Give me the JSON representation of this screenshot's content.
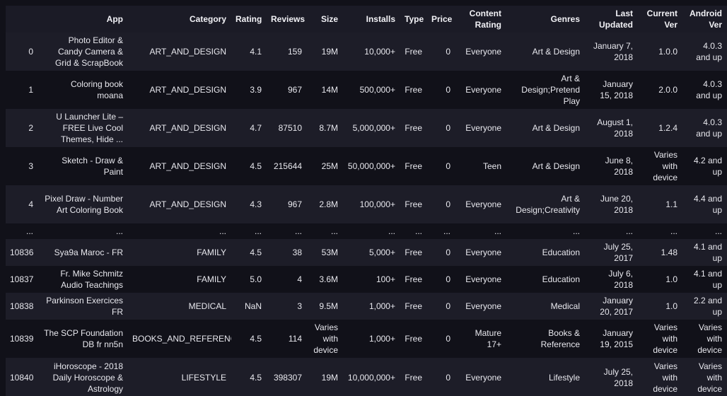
{
  "table": {
    "index_header": "",
    "columns": [
      "App",
      "Category",
      "Rating",
      "Reviews",
      "Size",
      "Installs",
      "Type",
      "Price",
      "Content Rating",
      "Genres",
      "Last Updated",
      "Current Ver",
      "Android Ver"
    ],
    "rows": [
      {
        "index": "0",
        "cells": [
          "Photo Editor & Candy Camera & Grid & ScrapBook",
          "ART_AND_DESIGN",
          "4.1",
          "159",
          "19M",
          "10,000+",
          "Free",
          "0",
          "Everyone",
          "Art & Design",
          "January 7, 2018",
          "1.0.0",
          "4.0.3 and up"
        ]
      },
      {
        "index": "1",
        "cells": [
          "Coloring book moana",
          "ART_AND_DESIGN",
          "3.9",
          "967",
          "14M",
          "500,000+",
          "Free",
          "0",
          "Everyone",
          "Art & Design;Pretend Play",
          "January 15, 2018",
          "2.0.0",
          "4.0.3 and up"
        ]
      },
      {
        "index": "2",
        "cells": [
          "U Launcher Lite – FREE Live Cool Themes, Hide ...",
          "ART_AND_DESIGN",
          "4.7",
          "87510",
          "8.7M",
          "5,000,000+",
          "Free",
          "0",
          "Everyone",
          "Art & Design",
          "August 1, 2018",
          "1.2.4",
          "4.0.3 and up"
        ]
      },
      {
        "index": "3",
        "cells": [
          "Sketch - Draw & Paint",
          "ART_AND_DESIGN",
          "4.5",
          "215644",
          "25M",
          "50,000,000+",
          "Free",
          "0",
          "Teen",
          "Art & Design",
          "June 8, 2018",
          "Varies with device",
          "4.2 and up"
        ]
      },
      {
        "index": "4",
        "cells": [
          "Pixel Draw - Number Art Coloring Book",
          "ART_AND_DESIGN",
          "4.3",
          "967",
          "2.8M",
          "100,000+",
          "Free",
          "0",
          "Everyone",
          "Art & Design;Creativity",
          "June 20, 2018",
          "1.1",
          "4.4 and up"
        ]
      },
      {
        "index": "...",
        "cells": [
          "...",
          "...",
          "...",
          "...",
          "...",
          "...",
          "...",
          "...",
          "...",
          "...",
          "...",
          "...",
          "..."
        ]
      },
      {
        "index": "10836",
        "cells": [
          "Sya9a Maroc - FR",
          "FAMILY",
          "4.5",
          "38",
          "53M",
          "5,000+",
          "Free",
          "0",
          "Everyone",
          "Education",
          "July 25, 2017",
          "1.48",
          "4.1 and up"
        ]
      },
      {
        "index": "10837",
        "cells": [
          "Fr. Mike Schmitz Audio Teachings",
          "FAMILY",
          "5.0",
          "4",
          "3.6M",
          "100+",
          "Free",
          "0",
          "Everyone",
          "Education",
          "July 6, 2018",
          "1.0",
          "4.1 and up"
        ]
      },
      {
        "index": "10838",
        "cells": [
          "Parkinson Exercices FR",
          "MEDICAL",
          "NaN",
          "3",
          "9.5M",
          "1,000+",
          "Free",
          "0",
          "Everyone",
          "Medical",
          "January 20, 2017",
          "1.0",
          "2.2 and up"
        ]
      },
      {
        "index": "10839",
        "cells": [
          "The SCP Foundation DB fr nn5n",
          "BOOKS_AND_REFERENCE",
          "4.5",
          "114",
          "Varies with device",
          "1,000+",
          "Free",
          "0",
          "Mature 17+",
          "Books & Reference",
          "January 19, 2015",
          "Varies with device",
          "Varies with device"
        ]
      },
      {
        "index": "10840",
        "cells": [
          "iHoroscope - 2018 Daily Horoscope & Astrology",
          "LIFESTYLE",
          "4.5",
          "398307",
          "19M",
          "10,000,000+",
          "Free",
          "0",
          "Everyone",
          "Lifestyle",
          "July 25, 2018",
          "Varies with device",
          "Varies with device"
        ]
      }
    ]
  },
  "colors": {
    "background": "#111119",
    "header_background": "#1b1b26",
    "row_stripe": "#1d1d28",
    "text": "#e8e8ee"
  }
}
